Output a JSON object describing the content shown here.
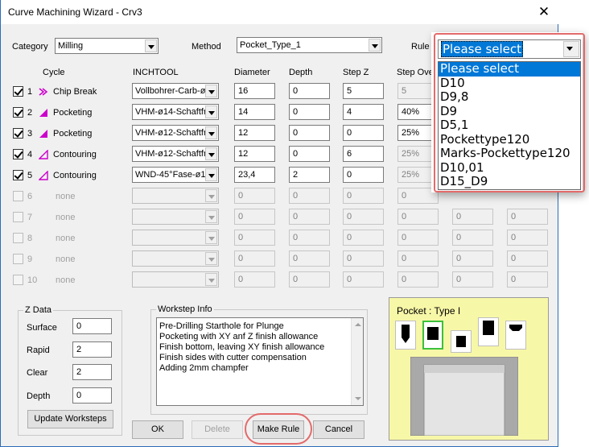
{
  "window": {
    "title": "Curve Machining Wizard - Crv3",
    "close_glyph": "✕"
  },
  "header": {
    "category_label": "Category",
    "category_value": "Milling",
    "method_label": "Method",
    "method_value": "Pocket_Type_1",
    "rule_label": "Rule",
    "rule_value": "Please select"
  },
  "columns": {
    "cycle": "Cycle",
    "tool": "INCHTOOL",
    "diameter": "Diameter",
    "depth": "Depth",
    "stepz": "Step Z",
    "stepover": "Step Over"
  },
  "rows": [
    {
      "num": "1",
      "checked": true,
      "icon": "chip-break-icon",
      "cycle": "Chip Break",
      "tool": "Vollbohrer-Carb-ø",
      "diameter": "16",
      "depth": "0",
      "stepz": "5",
      "stepover": "5"
    },
    {
      "num": "2",
      "checked": true,
      "icon": "pocketing-icon",
      "cycle": "Pocketing",
      "tool": "VHM-ø14-Schaftfr",
      "diameter": "14",
      "depth": "0",
      "stepz": "4",
      "stepover": "40%"
    },
    {
      "num": "3",
      "checked": true,
      "icon": "pocketing-icon",
      "cycle": "Pocketing",
      "tool": "VHM-ø12-Schaftfr",
      "diameter": "12",
      "depth": "0",
      "stepz": "0",
      "stepover": "25%"
    },
    {
      "num": "4",
      "checked": true,
      "icon": "contouring-icon",
      "cycle": "Contouring",
      "tool": "VHM-ø12-Schaftfr",
      "diameter": "12",
      "depth": "0",
      "stepz": "6",
      "stepover": "25%"
    },
    {
      "num": "5",
      "checked": true,
      "icon": "contouring-icon",
      "cycle": "Contouring",
      "tool": "WND-45°Fase-ø1",
      "diameter": "23,4",
      "depth": "2",
      "stepz": "0",
      "stepover": "25%"
    },
    {
      "num": "6",
      "checked": false,
      "cycle": "none",
      "tool": "",
      "diameter": "0",
      "depth": "0",
      "stepz": "0",
      "stepover": "0"
    },
    {
      "num": "7",
      "checked": false,
      "cycle": "none",
      "tool": "",
      "diameter": "0",
      "depth": "0",
      "stepz": "0",
      "stepover": "0"
    },
    {
      "num": "8",
      "checked": false,
      "cycle": "none",
      "tool": "",
      "diameter": "0",
      "depth": "0",
      "stepz": "0",
      "stepover": "0"
    },
    {
      "num": "9",
      "checked": false,
      "cycle": "none",
      "tool": "",
      "diameter": "0",
      "depth": "0",
      "stepz": "0",
      "stepover": "0"
    },
    {
      "num": "10",
      "checked": false,
      "cycle": "none",
      "tool": "",
      "diameter": "0",
      "depth": "0",
      "stepz": "0",
      "stepover": "0"
    }
  ],
  "extra_columns": {
    "col7": [
      "",
      "",
      "",
      "",
      "",
      "0",
      "0",
      "0",
      "0",
      "0"
    ],
    "col8": [
      "",
      "",
      "",
      "",
      "",
      "0",
      "0",
      "0",
      "0",
      "0"
    ]
  },
  "rule_options": [
    "Please select",
    "D10",
    "D9,8",
    "D9",
    "D5,1",
    "Pockettype120",
    "Marks-Pockettype120",
    "D10,01",
    "D15_D9"
  ],
  "zdata": {
    "title": "Z Data",
    "surface_label": "Surface",
    "surface": "0",
    "rapid_label": "Rapid",
    "rapid": "2",
    "clear_label": "Clear",
    "clear": "2",
    "depth_label": "Depth",
    "depth": "0",
    "update_button": "Update Worksteps"
  },
  "workstep": {
    "title": "Workstep Info",
    "lines": [
      "Pre-Drilling Starthole for Plunge",
      "Pocketing with XY anf Z finish allowance",
      "Finish bottom, leaving XY finish allowance",
      "Finish sides with cutter compensation",
      "Adding 2mm champfer"
    ]
  },
  "buttons": {
    "ok": "OK",
    "delete": "Delete",
    "make_rule": "Make Rule",
    "cancel": "Cancel"
  },
  "pocket": {
    "title": "Pocket :   Type I"
  },
  "colors": {
    "selection": "#0078d7",
    "highlight": "#e36a6a",
    "cycle_icon": "#cc00cc",
    "panel": "#f7f7a8"
  }
}
